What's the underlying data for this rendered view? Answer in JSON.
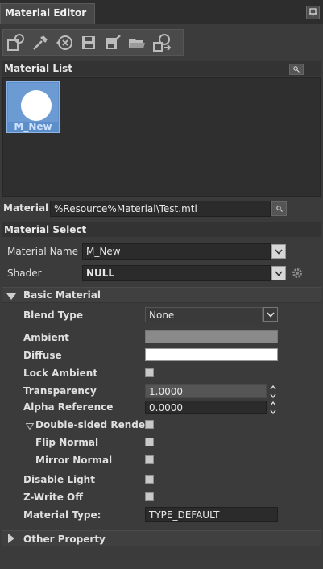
{
  "window": {
    "title": "Material Editor"
  },
  "toolbar": {
    "buttons": [
      {
        "name": "new-material-icon"
      },
      {
        "name": "eyedropper-icon"
      },
      {
        "name": "reset-icon"
      },
      {
        "name": "save-icon"
      },
      {
        "name": "save-as-icon"
      },
      {
        "name": "open-folder-icon"
      },
      {
        "name": "assign-material-icon"
      }
    ]
  },
  "material_list": {
    "header": "Material List",
    "items": [
      {
        "label": "M_New",
        "selected": true
      }
    ]
  },
  "material_file": {
    "label": "Material F",
    "value": "%Resource%Material\\Test.mtl"
  },
  "material_select": {
    "header": "Material Select",
    "name_label": "Material Name",
    "name_value": "M_New",
    "shader_label": "Shader",
    "shader_value": "NULL"
  },
  "basic_material": {
    "header": "Basic Material",
    "blend_type_label": "Blend Type",
    "blend_type_value": "None",
    "ambient_label": "Ambient",
    "ambient_color": "#8a8a8a",
    "diffuse_label": "Diffuse",
    "diffuse_color": "#ffffff",
    "lock_ambient_label": "Lock Ambient",
    "transparency_label": "Transparency",
    "transparency_value": "1.0000",
    "alpha_ref_label": "Alpha Reference",
    "alpha_ref_value": "0.0000",
    "double_sided_label": "Double-sided Render",
    "flip_normal_label": "Flip Normal",
    "mirror_normal_label": "Mirror Normal",
    "disable_light_label": "Disable Light",
    "zwrite_off_label": "Z-Write Off",
    "material_type_label": "Material Type:",
    "material_type_value": "TYPE_DEFAULT"
  },
  "other_property": {
    "header": "Other Property"
  },
  "colors": {
    "accent": "#5c8fc9",
    "panel": "#3b3b3b",
    "field": "#2b2b2b"
  }
}
